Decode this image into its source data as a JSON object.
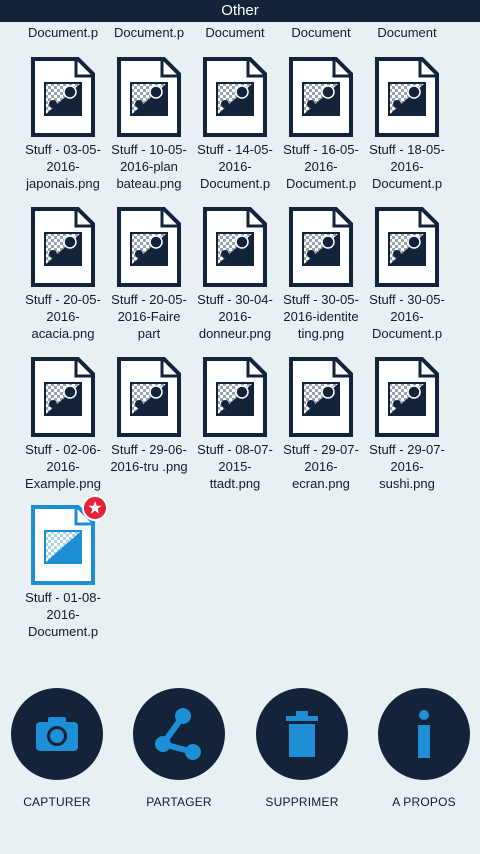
{
  "header": {
    "title": "Other"
  },
  "partial_row": [
    "Document.p",
    "Document.p",
    "Document",
    "Document",
    "Document"
  ],
  "files": [
    {
      "name": "Stuff - 03-05-2016-japonais.png",
      "lines": [
        "Stuff - 03-05-",
        "2016-",
        "japonais.png"
      ]
    },
    {
      "name": "Stuff - 10-05-2016-plan bateau.png",
      "lines": [
        "Stuff - 10-05-",
        "2016-plan",
        "bateau.png"
      ]
    },
    {
      "name": "Stuff - 14-05-2016-Document.p",
      "lines": [
        "Stuff - 14-05-",
        "2016-",
        "Document.p"
      ]
    },
    {
      "name": "Stuff - 16-05-2016-Document.p",
      "lines": [
        "Stuff - 16-05-",
        "2016-",
        "Document.p"
      ]
    },
    {
      "name": "Stuff - 18-05-2016-Document.p",
      "lines": [
        "Stuff - 18-05-",
        "2016-",
        "Document.p"
      ]
    },
    {
      "name": "Stuff - 20-05-2016-acacia.png",
      "lines": [
        "Stuff - 20-05-",
        "2016-",
        "acacia.png"
      ]
    },
    {
      "name": "Stuff - 20-05-2016-Faire part",
      "lines": [
        "Stuff - 20-05-",
        "2016-Faire",
        "part"
      ]
    },
    {
      "name": "Stuff - 30-04-2016-donneur.png",
      "lines": [
        "Stuff - 30-04-",
        "2016-",
        "donneur.png"
      ]
    },
    {
      "name": "Stuff - 30-05-2016-identiteting.png",
      "lines": [
        "Stuff - 30-05-",
        "2016-identite",
        "ting.png"
      ]
    },
    {
      "name": "Stuff - 30-05-2016-Document.p",
      "lines": [
        "Stuff - 30-05-",
        "2016-",
        "Document.p"
      ]
    },
    {
      "name": "Stuff - 02-06-2016-Example.png",
      "lines": [
        "Stuff - 02-06-",
        "2016-",
        "Example.png"
      ]
    },
    {
      "name": "Stuff - 29-06-2016-tru .png",
      "lines": [
        "Stuff - 29-06-",
        "2016-tru .png"
      ]
    },
    {
      "name": "Stuff - 08-07-2015-ttadt.png",
      "lines": [
        "Stuff - 08-07-",
        "2015-",
        "ttadt.png"
      ]
    },
    {
      "name": "Stuff - 29-07-2016-ecran.png",
      "lines": [
        "Stuff - 29-07-",
        "2016-",
        "ecran.png"
      ]
    },
    {
      "name": "Stuff - 29-07-2016-sushi.png",
      "lines": [
        "Stuff - 29-07-",
        "2016-",
        "sushi.png"
      ]
    },
    {
      "name": "Stuff - 01-08-2016-Document.p",
      "lines": [
        "Stuff - 01-08-",
        "2016-",
        "Document.p"
      ],
      "selected": true
    }
  ],
  "actions": [
    {
      "label": "CAPTURER",
      "icon": "camera-icon"
    },
    {
      "label": "PARTAGER",
      "icon": "share-icon"
    },
    {
      "label": "SUPPRIMER",
      "icon": "trash-icon"
    },
    {
      "label": "A PROPOS",
      "icon": "info-icon"
    }
  ],
  "colors": {
    "background": "#e9f0f4",
    "dark": "#12233a",
    "accent": "#1e8fd6",
    "badge": "#e8203a"
  }
}
